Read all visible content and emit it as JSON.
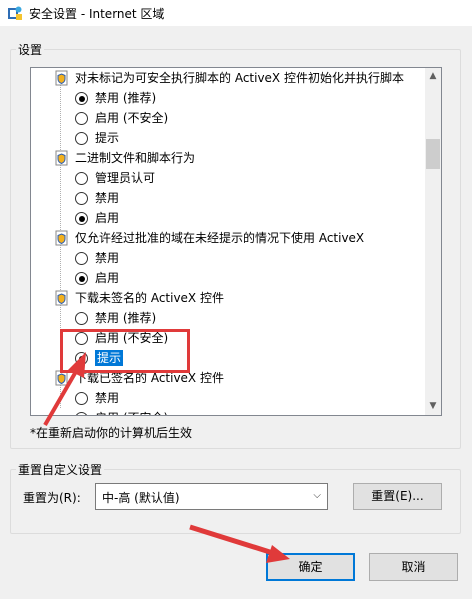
{
  "window": {
    "title": "安全设置 - Internet 区域",
    "icon": "security-settings-icon"
  },
  "settings_group": {
    "label": "设置",
    "items": [
      {
        "type": "heading",
        "label": "对未标记为可安全执行脚本的 ActiveX 控件初始化并执行脚本",
        "icon": "shield-icon"
      },
      {
        "type": "option",
        "label": "禁用 (推荐)",
        "checked": true
      },
      {
        "type": "option",
        "label": "启用 (不安全)",
        "checked": false
      },
      {
        "type": "option",
        "label": "提示",
        "checked": false
      },
      {
        "type": "heading",
        "label": "二进制文件和脚本行为",
        "icon": "shield-icon"
      },
      {
        "type": "option",
        "label": "管理员认可",
        "checked": false
      },
      {
        "type": "option",
        "label": "禁用",
        "checked": false
      },
      {
        "type": "option",
        "label": "启用",
        "checked": true
      },
      {
        "type": "heading",
        "label": "仅允许经过批准的域在未经提示的情况下使用 ActiveX",
        "icon": "shield-icon"
      },
      {
        "type": "option",
        "label": "禁用",
        "checked": false
      },
      {
        "type": "option",
        "label": "启用",
        "checked": true
      },
      {
        "type": "heading",
        "label": "下载未签名的 ActiveX 控件",
        "icon": "shield-icon"
      },
      {
        "type": "option",
        "label": "禁用 (推荐)",
        "checked": false
      },
      {
        "type": "option",
        "label": "启用 (不安全)",
        "checked": false
      },
      {
        "type": "option",
        "label": "提示",
        "checked": true,
        "selected": true
      },
      {
        "type": "heading",
        "label": "下载已签名的 ActiveX 控件",
        "icon": "shield-icon"
      },
      {
        "type": "option",
        "label": "禁用",
        "checked": false
      },
      {
        "type": "option",
        "label": "启用 (不安全)",
        "checked": false
      }
    ],
    "note": "*在重新启动你的计算机后生效"
  },
  "reset_group": {
    "label": "重置自定义设置",
    "reset_to_label": "重置为(R):",
    "combo_value": "中-高 (默认值)",
    "reset_button": "重置(E)..."
  },
  "footer": {
    "ok_button": "确定",
    "cancel_button": "取消"
  },
  "annotation": {
    "color": "#e03a3a"
  }
}
